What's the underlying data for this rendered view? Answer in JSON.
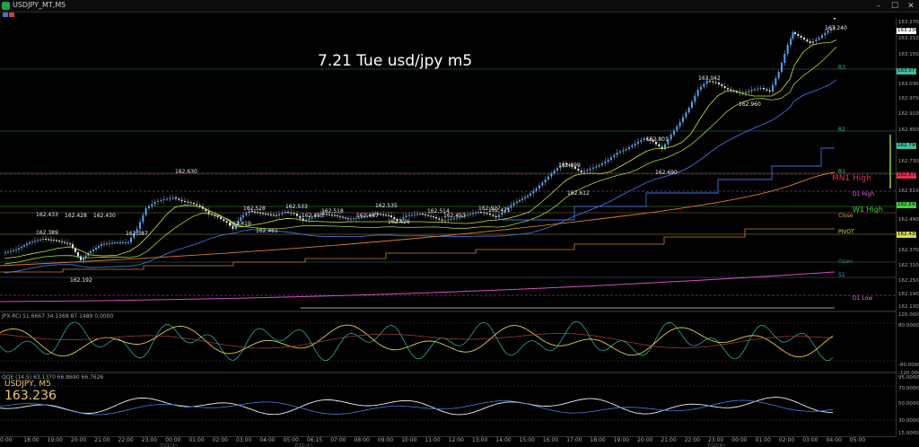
{
  "window": {
    "title": "USDJPY_MT,M5",
    "minimize_icon": "–",
    "maximize_icon": "☐",
    "close_icon": "✕"
  },
  "chart": {
    "title": "7.21 Tue usd/jpy m5",
    "symbol_label": "USDJPY, M5",
    "symbol_price": "163.236",
    "rci_header": "JPX-RCI 51.6667 34.1368 87.1489 0.0000",
    "qqe_header": "QQE (14,5) 63.1370 66.8690 66.7626"
  },
  "price_annotations": [
    {
      "text": "162.433"
    },
    {
      "text": "162.389"
    },
    {
      "text": "162.428"
    },
    {
      "text": "162.430"
    },
    {
      "text": "162.387"
    },
    {
      "text": "162.192"
    },
    {
      "text": "162.630"
    },
    {
      "text": "162.528"
    },
    {
      "text": "162.461"
    },
    {
      "text": "162.419"
    },
    {
      "text": "162.533"
    },
    {
      "text": "162.453"
    },
    {
      "text": "162.518"
    },
    {
      "text": "162.447"
    },
    {
      "text": "162.535"
    },
    {
      "text": "162.426"
    },
    {
      "text": "162.514"
    },
    {
      "text": "162.453"
    },
    {
      "text": "162.527"
    },
    {
      "text": "162.471"
    },
    {
      "text": "162.699"
    },
    {
      "text": "162.612"
    },
    {
      "text": "162.801"
    },
    {
      "text": "162.690"
    },
    {
      "text": "163.042"
    },
    {
      "text": "162.960"
    },
    {
      "text": "163.240"
    }
  ],
  "levels": [
    {
      "text": "R3",
      "color": "#3fbf9f"
    },
    {
      "text": "R2",
      "color": "#3fbf9f"
    },
    {
      "text": "R1",
      "color": "#3fbf9f"
    },
    {
      "text": "MN1 High",
      "color": "#e0304a"
    },
    {
      "text": "D1 High",
      "color": "#d86fd8"
    },
    {
      "text": "W1 High",
      "color": "#3fd03f"
    },
    {
      "text": "Close",
      "color": "#d8a050"
    },
    {
      "text": "PIVOT",
      "color": "#d8d850"
    },
    {
      "text": "Open",
      "color": "#3f7f7f"
    },
    {
      "text": "S1",
      "color": "#3f9fdf"
    },
    {
      "text": "D1 Low",
      "color": "#d86fd8"
    }
  ],
  "scale": {
    "labels": [
      "163.270",
      "163.236",
      "163.210",
      "163.150",
      "163.077",
      "163.030",
      "162.970",
      "162.910",
      "162.850",
      "162.790",
      "162.730",
      "162.670",
      "162.610",
      "162.547",
      "162.490",
      "162.430",
      "162.370",
      "162.310",
      "162.250",
      "162.190",
      "162.130"
    ],
    "ind_labels": [
      "120.0000",
      "80.0000",
      "-80.0000",
      "-120.0000",
      "95.0000",
      "70.0000",
      "50.0000",
      "30.0000",
      "15.0000"
    ]
  },
  "time_axis": {
    "labels": [
      "0:00",
      "18:00",
      "19:00",
      "20:00",
      "21:00",
      "22:00",
      "23:00",
      "00:00",
      "01:00",
      "02:00",
      "03:00",
      "04:00",
      "05:00",
      "06:15",
      "07:00",
      "08:00",
      "09:00",
      "10:00",
      "11:00",
      "12:00",
      "13:00",
      "14:00",
      "15:00",
      "16:00",
      "17:00",
      "18:00",
      "19:00",
      "20:00",
      "21:00",
      "22:00",
      "23:00",
      "00:00",
      "01:00",
      "02:00",
      "03:00",
      "04:00",
      "05:00"
    ],
    "dates": [
      "7/21(火)",
      "7/21(火)",
      "7/22(水)"
    ]
  },
  "colors": {
    "candle_up": "#4da3ff",
    "candle_down": "#e8e8e8",
    "ma_fast": "#c8e830",
    "ma_mid": "#9fd83f",
    "ma_slow": "#3f6fdf",
    "ma_long": "#e07a2a",
    "step": "#3f6fdf",
    "pink": "#d84fbf"
  }
}
